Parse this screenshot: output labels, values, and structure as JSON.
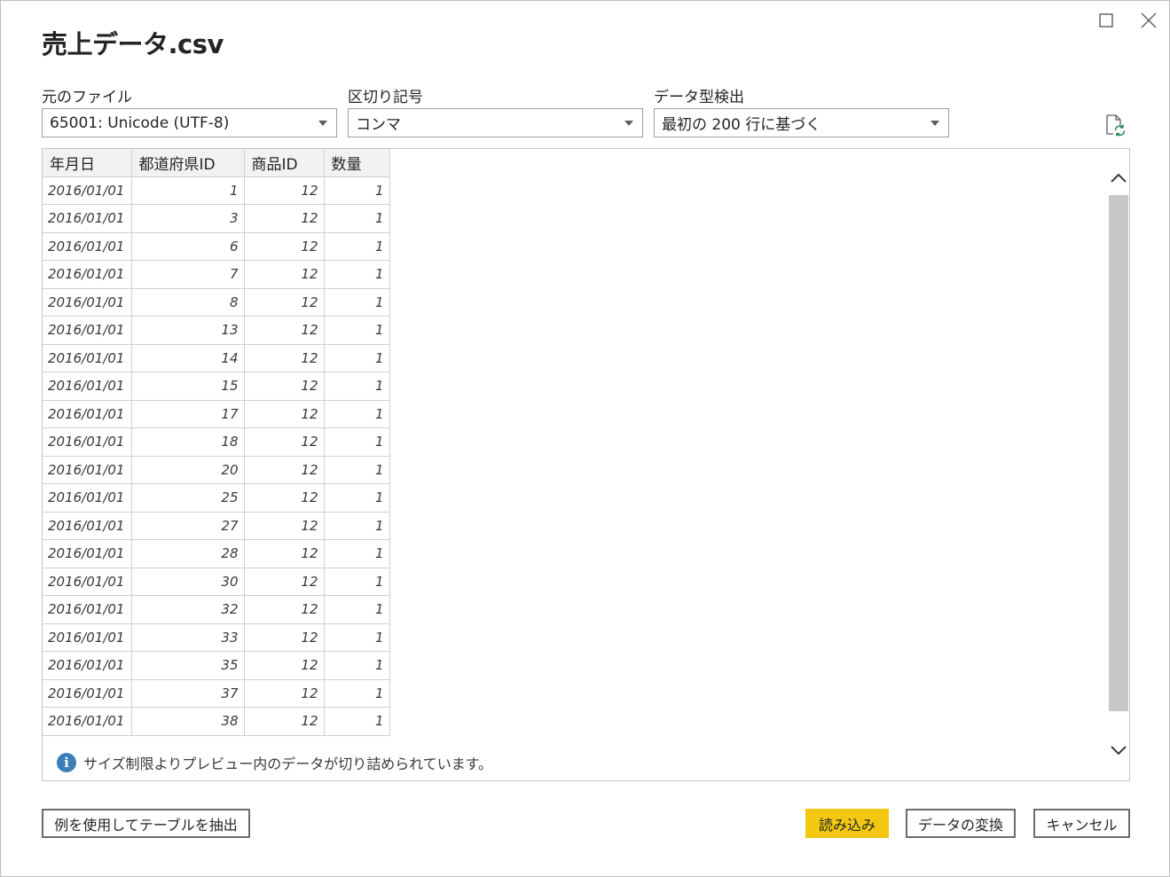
{
  "dialog": {
    "title": "売上データ.csv",
    "window_controls": {
      "maximize_icon": "maximize-icon",
      "close_icon": "close-icon"
    }
  },
  "options": {
    "file_origin": {
      "label": "元のファイル",
      "value": "65001: Unicode (UTF-8)"
    },
    "delimiter": {
      "label": "区切り記号",
      "value": "コンマ"
    },
    "type_detection": {
      "label": "データ型検出",
      "value": "最初の 200 行に基づく"
    },
    "refresh_icon": "refresh-file-icon"
  },
  "table": {
    "columns": [
      "年月日",
      "都道府県ID",
      "商品ID",
      "数量"
    ],
    "rows": [
      [
        "2016/01/01",
        "1",
        "12",
        "1"
      ],
      [
        "2016/01/01",
        "3",
        "12",
        "1"
      ],
      [
        "2016/01/01",
        "6",
        "12",
        "1"
      ],
      [
        "2016/01/01",
        "7",
        "12",
        "1"
      ],
      [
        "2016/01/01",
        "8",
        "12",
        "1"
      ],
      [
        "2016/01/01",
        "13",
        "12",
        "1"
      ],
      [
        "2016/01/01",
        "14",
        "12",
        "1"
      ],
      [
        "2016/01/01",
        "15",
        "12",
        "1"
      ],
      [
        "2016/01/01",
        "17",
        "12",
        "1"
      ],
      [
        "2016/01/01",
        "18",
        "12",
        "1"
      ],
      [
        "2016/01/01",
        "20",
        "12",
        "1"
      ],
      [
        "2016/01/01",
        "25",
        "12",
        "1"
      ],
      [
        "2016/01/01",
        "27",
        "12",
        "1"
      ],
      [
        "2016/01/01",
        "28",
        "12",
        "1"
      ],
      [
        "2016/01/01",
        "30",
        "12",
        "1"
      ],
      [
        "2016/01/01",
        "32",
        "12",
        "1"
      ],
      [
        "2016/01/01",
        "33",
        "12",
        "1"
      ],
      [
        "2016/01/01",
        "35",
        "12",
        "1"
      ],
      [
        "2016/01/01",
        "37",
        "12",
        "1"
      ],
      [
        "2016/01/01",
        "38",
        "12",
        "1"
      ]
    ]
  },
  "notice": {
    "icon": "info-icon",
    "text": "サイズ制限よりプレビュー内のデータが切り詰められています。"
  },
  "buttons": {
    "extract_table": "例を使用してテーブルを抽出",
    "load": "読み込み",
    "transform": "データの変換",
    "cancel": "キャンセル"
  },
  "colors": {
    "primary_button": "#f2c811",
    "info_icon": "#3b7fb8",
    "header_bg": "#f3f2f1"
  }
}
